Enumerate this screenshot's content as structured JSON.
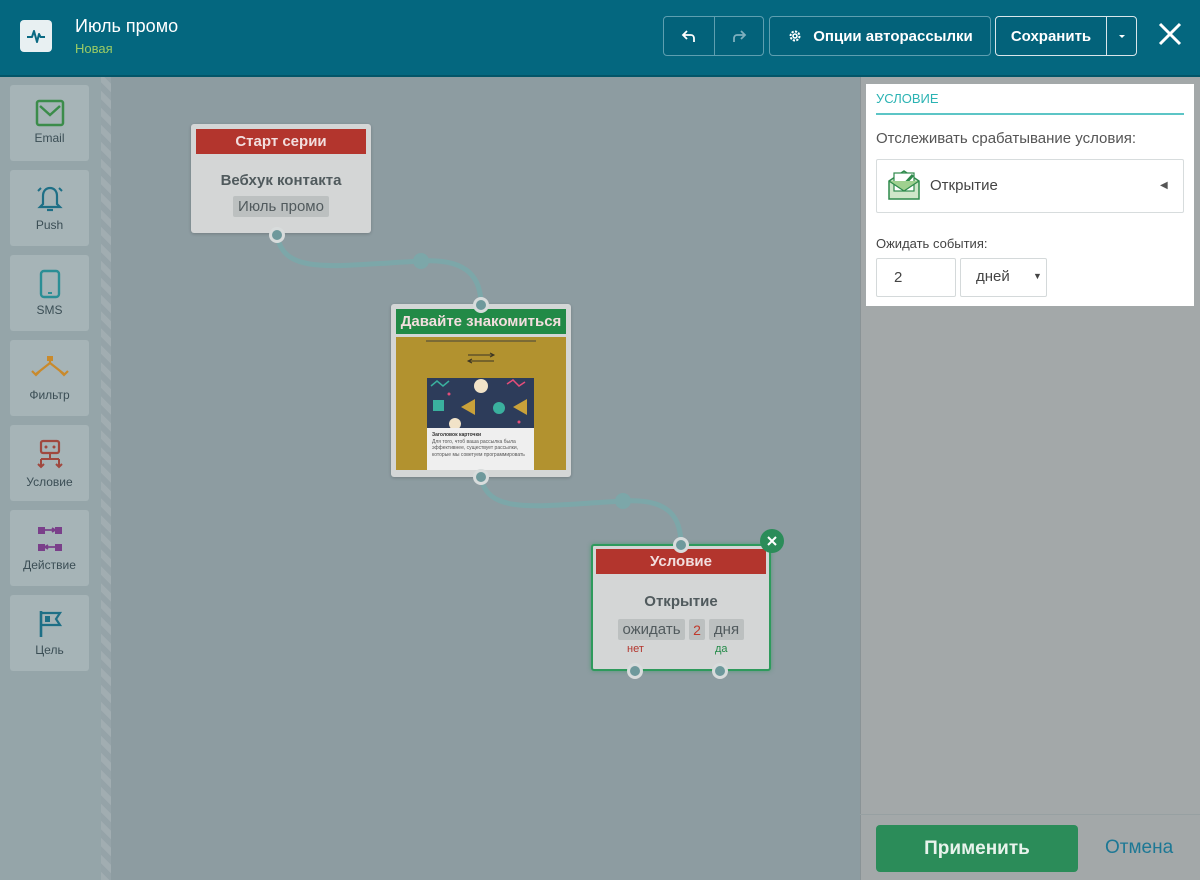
{
  "header": {
    "title": "Июль промо",
    "subtitle": "Новая",
    "options_label": "Опции авторассылки",
    "save_label": "Сохранить"
  },
  "palette": {
    "items": [
      {
        "label": "Email",
        "icon": "email-icon",
        "color": "#3b8c4a"
      },
      {
        "label": "Push",
        "icon": "bell-icon",
        "color": "#1e6f86"
      },
      {
        "label": "SMS",
        "icon": "phone-icon",
        "color": "#2b8e95"
      },
      {
        "label": "Фильтр",
        "icon": "filter-icon",
        "color": "#c98a2c"
      },
      {
        "label": "Условие",
        "icon": "condition-icon",
        "color": "#a0483e"
      },
      {
        "label": "Действие",
        "icon": "action-icon",
        "color": "#7a3f8a"
      },
      {
        "label": "Цель",
        "icon": "flag-icon",
        "color": "#1e6f86"
      }
    ]
  },
  "nodes": {
    "start": {
      "header": "Старт серии",
      "title": "Вебхук контакта",
      "tag": "Июль промо",
      "header_color": "#b3352d"
    },
    "email": {
      "header": "Давайте знакомиться",
      "header_color": "#228a47",
      "preview": {
        "card_title": "Заголовок карточки",
        "card_text": "Для того, чтоб ваша рассылка была эффективнее, существует рассылки, которые мы советуем программировать"
      }
    },
    "condition": {
      "header": "Условие",
      "title": "Открытие",
      "wait_label": "ожидать",
      "wait_value": "2",
      "wait_unit": "дня",
      "no_label": "нет",
      "yes_label": "да",
      "header_color": "#b3352d"
    }
  },
  "panel": {
    "heading": "УСЛОВИЕ",
    "track_label": "Отслеживать срабатывание условия:",
    "selected_condition": "Открытие",
    "wait_label": "Ожидать события:",
    "wait_value": "2",
    "wait_unit": "дней",
    "apply_label": "Применить",
    "cancel_label": "Отмена"
  }
}
